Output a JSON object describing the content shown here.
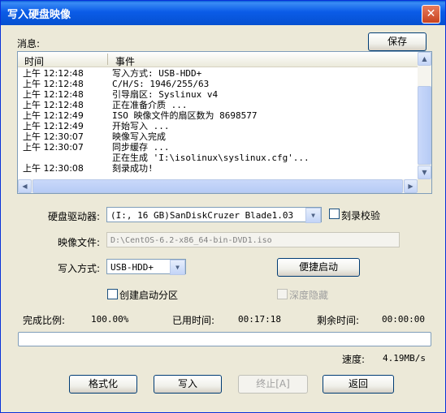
{
  "window": {
    "title": "写入硬盘映像",
    "close_label": "✕"
  },
  "messages": {
    "label": "消息:",
    "save_label": "保存",
    "columns": {
      "time": "时间",
      "event": "事件"
    },
    "rows": [
      {
        "time": "上午 12:12:48",
        "event": "写入方式: USB-HDD+"
      },
      {
        "time": "上午 12:12:48",
        "event": "C/H/S: 1946/255/63"
      },
      {
        "time": "上午 12:12:48",
        "event": "引导扇区: Syslinux v4"
      },
      {
        "time": "上午 12:12:48",
        "event": "正在准备介质 ..."
      },
      {
        "time": "上午 12:12:49",
        "event": "ISO 映像文件的扇区数为 8698577"
      },
      {
        "time": "上午 12:12:49",
        "event": "开始写入 ..."
      },
      {
        "time": "上午 12:30:07",
        "event": "映像写入完成"
      },
      {
        "time": "上午 12:30:07",
        "event": "同步缓存 ..."
      },
      {
        "time": "",
        "event": "正在生成 'I:\\isolinux\\syslinux.cfg'..."
      },
      {
        "time": "上午 12:30:08",
        "event": "刻录成功!"
      }
    ]
  },
  "form": {
    "drive_label": "硬盘驱动器:",
    "drive_value": "(I:, 16 GB)SanDiskCruzer Blade1.03",
    "verify_label": "刻录校验",
    "image_label": "映像文件:",
    "image_value": "D:\\CentOS-6.2-x86_64-bin-DVD1.iso",
    "method_label": "写入方式:",
    "method_value": "USB-HDD+",
    "quick_boot_label": "便捷启动",
    "create_partition_label": "创建启动分区",
    "hidden_label": "深度隐藏"
  },
  "status": {
    "percent_label": "完成比例:",
    "percent_value": "100.00%",
    "elapsed_label": "已用时间:",
    "elapsed_value": "00:17:18",
    "remaining_label": "剩余时间:",
    "remaining_value": "00:00:00",
    "progress_fraction": 1.0,
    "speed_label": "速度:",
    "speed_value": "4.19MB/s"
  },
  "buttons": {
    "format": "格式化",
    "write": "写入",
    "abort": "终止[A]",
    "back": "返回"
  },
  "icons": {
    "scroll_up": "▲",
    "scroll_down": "▼",
    "scroll_left": "◀",
    "scroll_right": "▶",
    "dropdown": "▼"
  }
}
